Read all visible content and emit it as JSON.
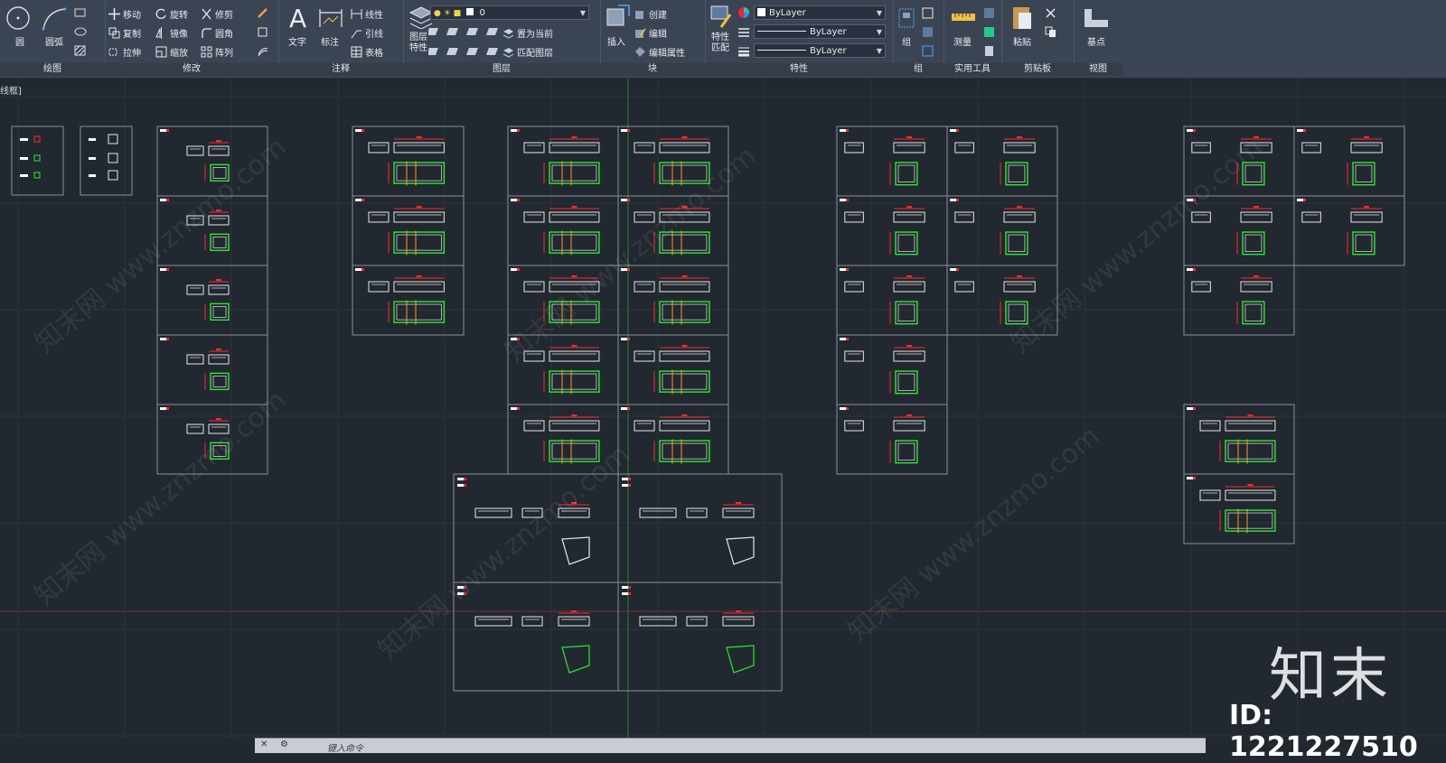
{
  "ribbon": {
    "draw": {
      "title": "绘图",
      "circle": "圆",
      "arc": "圆弧"
    },
    "modify": {
      "title": "修改",
      "move": "移动",
      "rotate": "旋转",
      "trim": "修剪",
      "copy": "复制",
      "mirror": "镜像",
      "fillet": "圆角",
      "stretch": "拉伸",
      "scale": "缩放",
      "array": "阵列"
    },
    "annotation": {
      "title": "注释",
      "text": "文字",
      "dimension": "标注",
      "linear": "线性",
      "leader": "引线",
      "table": "表格"
    },
    "layers": {
      "title": "图层",
      "layer_props": "图层\n特性",
      "layer_value": "0",
      "set_current": "置为当前",
      "match_layer": "匹配图层"
    },
    "block": {
      "title": "块",
      "insert": "插入",
      "create": "创建",
      "edit": "编辑",
      "edit_attr": "编辑属性"
    },
    "properties": {
      "title": "特性",
      "match": "特性\n匹配",
      "color": "ByLayer",
      "linetype": "ByLayer",
      "lineweight": "ByLayer"
    },
    "groups": {
      "title": "组",
      "group": "组"
    },
    "utilities": {
      "title": "实用工具",
      "measure": "测量"
    },
    "clipboard": {
      "title": "剪贴板",
      "paste": "粘贴"
    },
    "view": {
      "title": "视图",
      "base": "基点"
    }
  },
  "viewport_label": "线框]",
  "command_line": {
    "placeholder": "键入命令"
  },
  "brand": {
    "logo": "知末",
    "id": "ID: 1221227510",
    "watermark": "知末网 www.znzmo.com"
  },
  "colors": {
    "frame": "#8a9098",
    "drawing": "#e8e8e8",
    "green": "#2ee82e",
    "red": "#ff2a2a",
    "orange": "#ff9a1f"
  }
}
